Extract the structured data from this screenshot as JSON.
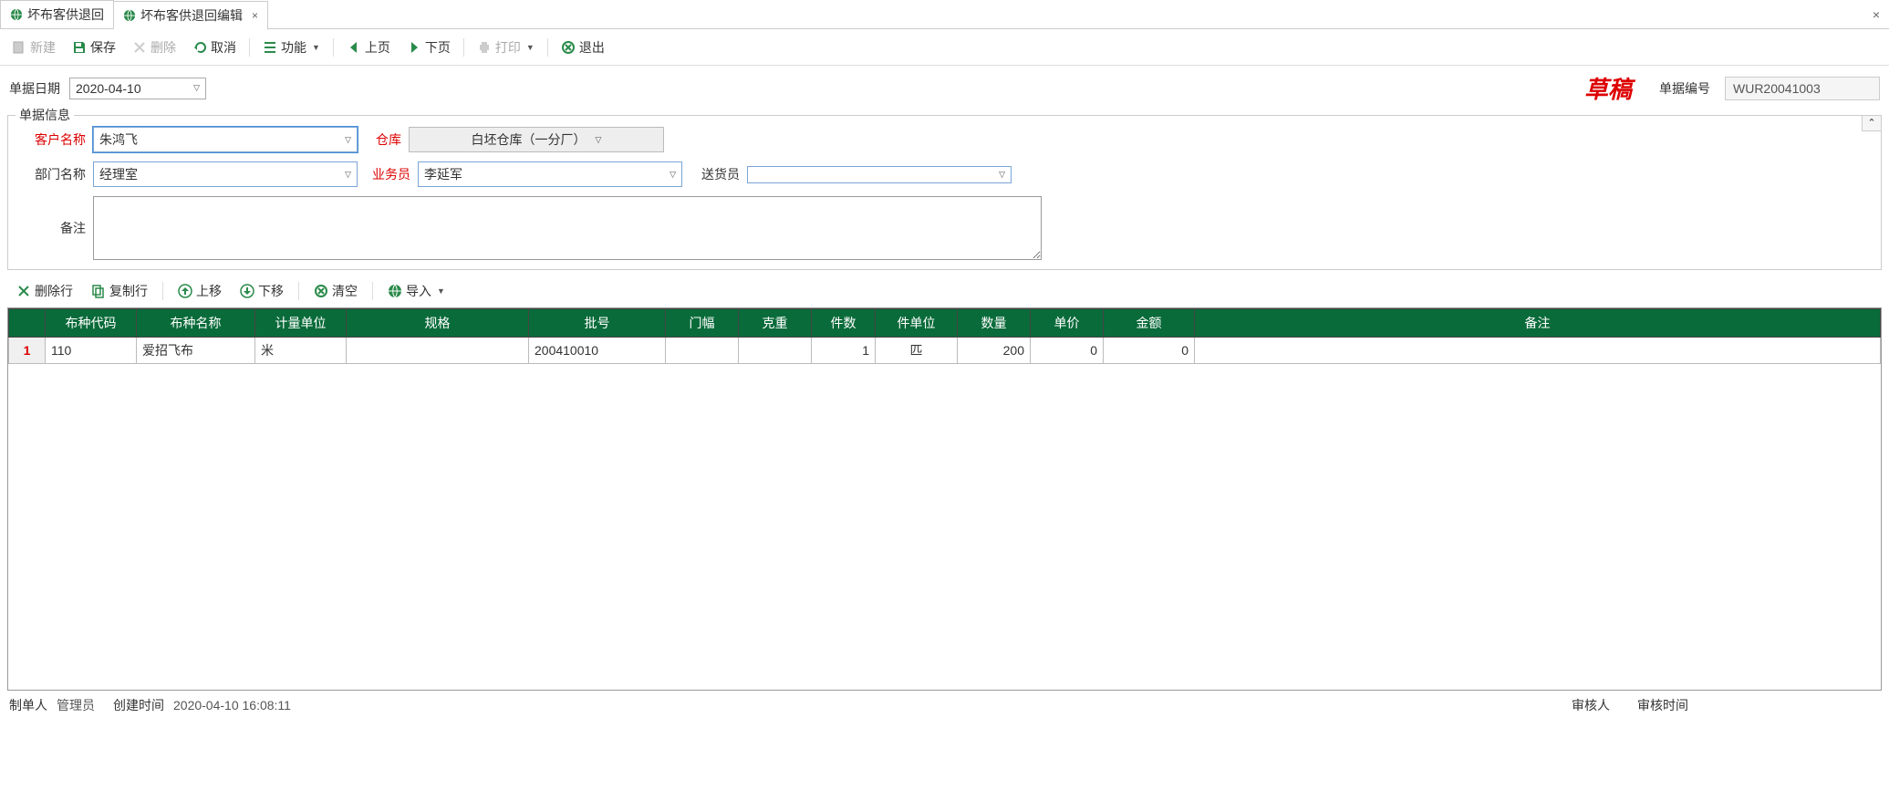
{
  "tabs": {
    "items": [
      {
        "label": "坏布客供退回",
        "closable": false,
        "active": false
      },
      {
        "label": "坏布客供退回编辑",
        "closable": true,
        "active": true
      }
    ]
  },
  "toolbar": {
    "new": "新建",
    "save": "保存",
    "delete": "删除",
    "cancel": "取消",
    "functions": "功能",
    "prev": "上页",
    "next": "下页",
    "print": "打印",
    "exit": "退出"
  },
  "header": {
    "date_label": "单据日期",
    "date_value": "2020-04-10",
    "status_text": "草稿",
    "doc_no_label": "单据编号",
    "doc_no_value": "WUR20041003"
  },
  "docInfo": {
    "legend": "单据信息",
    "customer_label": "客户名称",
    "customer_value": "朱鸿飞",
    "warehouse_label": "仓库",
    "warehouse_value": "白坯仓库（一分厂）",
    "dept_label": "部门名称",
    "dept_value": "经理室",
    "salesman_label": "业务员",
    "salesman_value": "李延军",
    "delivery_label": "送货员",
    "delivery_value": "",
    "remarks_label": "备注",
    "remarks_value": ""
  },
  "rowToolbar": {
    "delete_row": "删除行",
    "copy_row": "复制行",
    "move_up": "上移",
    "move_down": "下移",
    "clear": "清空",
    "import": "导入"
  },
  "grid": {
    "headers": {
      "code": "布种代码",
      "name": "布种名称",
      "uom": "计量单位",
      "spec": "规格",
      "batch": "批号",
      "width": "门幅",
      "gram": "克重",
      "pieces": "件数",
      "piece_uom": "件单位",
      "qty": "数量",
      "price": "单价",
      "amount": "金额",
      "remark": "备注"
    },
    "rows": [
      {
        "rownum": "1",
        "code": "110",
        "name": "爱招飞布",
        "uom": "米",
        "spec": "",
        "batch": "200410010",
        "width": "",
        "gram": "",
        "pieces": "1",
        "piece_uom": "匹",
        "qty": "200",
        "price": "0",
        "amount": "0",
        "remark": ""
      }
    ]
  },
  "footer": {
    "creator_label": "制单人",
    "creator_value": "管理员",
    "created_label": "创建时间",
    "created_value": "2020-04-10 16:08:11",
    "auditor_label": "审核人",
    "auditor_value": "",
    "audit_time_label": "审核时间",
    "audit_time_value": ""
  }
}
